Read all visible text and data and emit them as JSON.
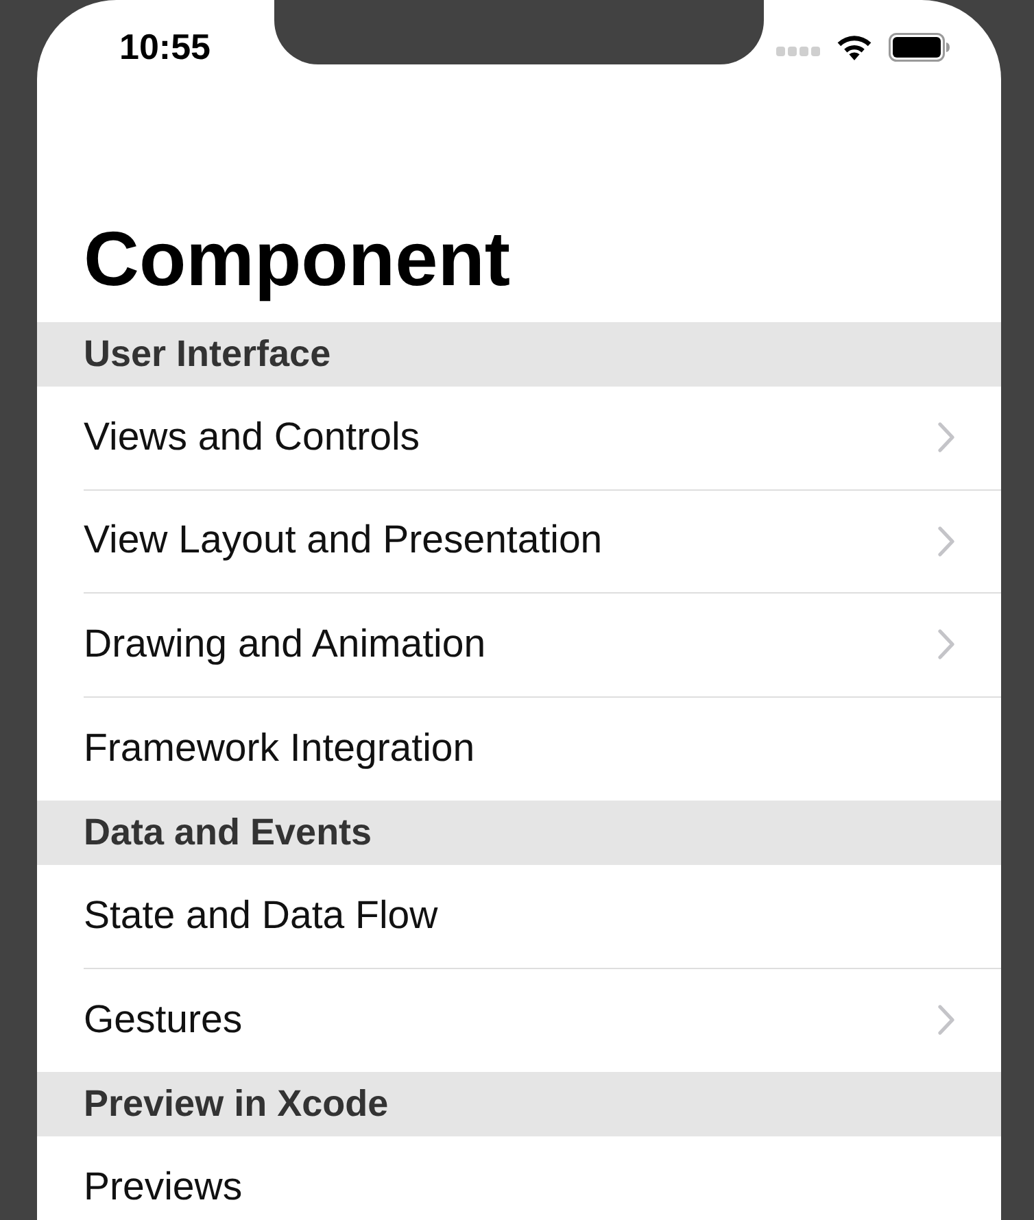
{
  "status_bar": {
    "time": "10:55"
  },
  "title": "Component",
  "sections": [
    {
      "header": "User Interface",
      "items": [
        {
          "label": "Views and Controls",
          "disclosure": true
        },
        {
          "label": "View Layout and Presentation",
          "disclosure": true
        },
        {
          "label": "Drawing and Animation",
          "disclosure": true
        },
        {
          "label": "Framework Integration",
          "disclosure": false
        }
      ]
    },
    {
      "header": "Data and Events",
      "items": [
        {
          "label": "State and Data Flow",
          "disclosure": false
        },
        {
          "label": "Gestures",
          "disclosure": true
        }
      ]
    },
    {
      "header": "Preview in Xcode",
      "items": [
        {
          "label": "Previews",
          "disclosure": false
        }
      ]
    }
  ]
}
